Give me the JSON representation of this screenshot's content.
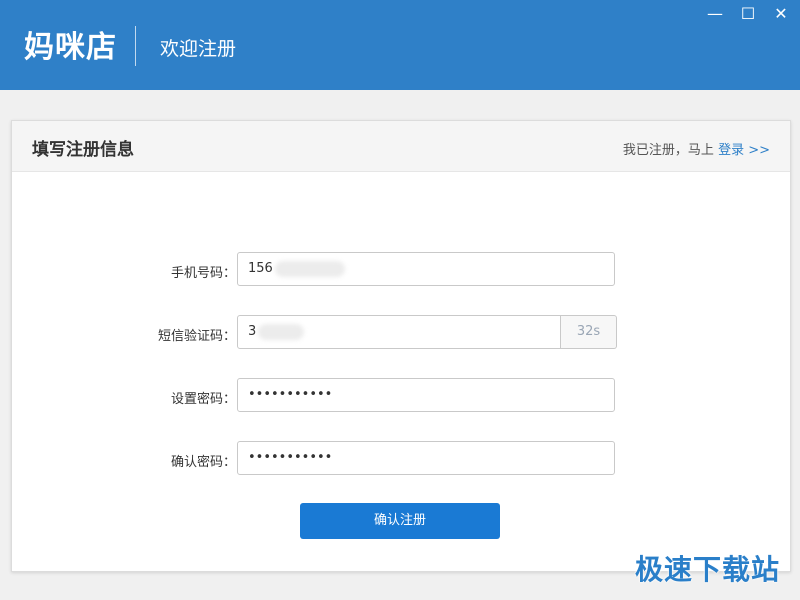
{
  "window": {
    "logo": "妈咪店",
    "subtitle": "欢迎注册",
    "controls": {
      "minimize": "—",
      "maximize": "☐",
      "close": "✕"
    }
  },
  "card": {
    "title": "填写注册信息",
    "login_prompt": "我已注册，马上",
    "login_link": "登录 >>"
  },
  "form": {
    "phone_label": "手机号码：",
    "phone_value": "156",
    "sms_label": "短信验证码：",
    "sms_value": "3",
    "sms_countdown": "32s",
    "password_label": "设置密码：",
    "password_value": "•••••••••••",
    "confirm_label": "确认密码：",
    "confirm_value": "•••••••••••",
    "submit_label": "确认注册"
  },
  "watermark": "极速下载站",
  "colors": {
    "brand": "#2f80c8",
    "button": "#1a7ad4"
  }
}
